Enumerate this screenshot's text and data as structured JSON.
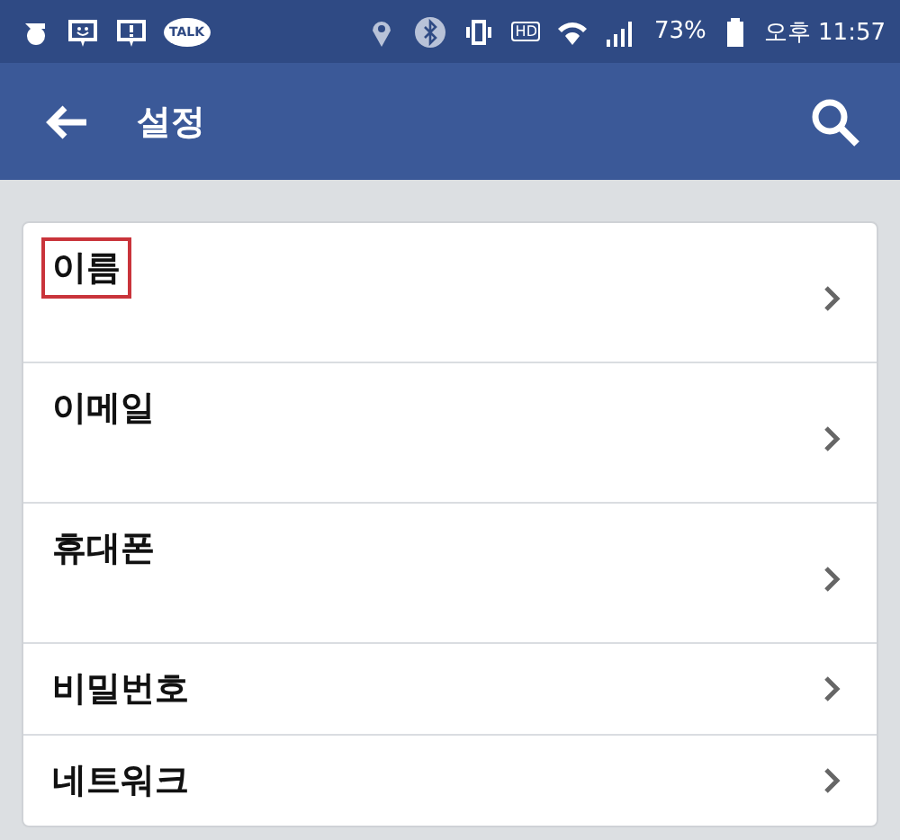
{
  "status_bar": {
    "talk_badge": "TALK",
    "hd_badge": "HD",
    "battery": "73%",
    "time": "오후 11:57"
  },
  "app_bar": {
    "title": "설정"
  },
  "settings": [
    {
      "label": "이름",
      "kind": "tall",
      "highlighted": true
    },
    {
      "label": "이메일",
      "kind": "tall",
      "highlighted": false
    },
    {
      "label": "휴대폰",
      "kind": "tall",
      "highlighted": false
    },
    {
      "label": "비밀번호",
      "kind": "short",
      "highlighted": false
    },
    {
      "label": "네트워크",
      "kind": "short",
      "highlighted": false
    }
  ]
}
